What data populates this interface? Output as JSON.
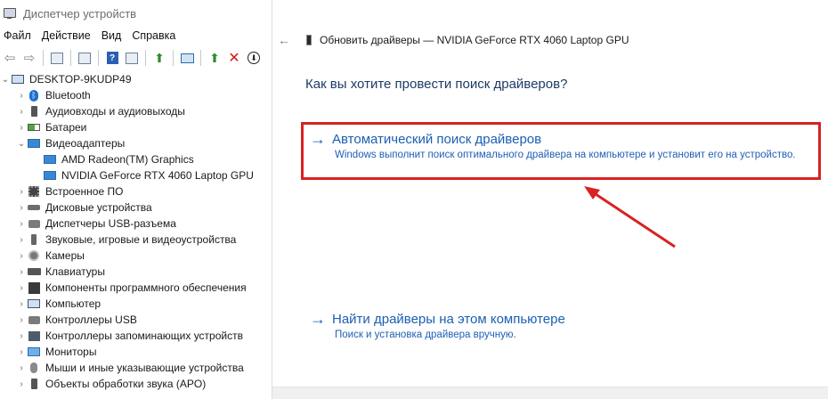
{
  "device_manager": {
    "title": "Диспетчер устройств",
    "menu": [
      "Файл",
      "Действие",
      "Вид",
      "Справка"
    ],
    "root": "DESKTOP-9KUDP49",
    "tree": [
      {
        "label": "Bluetooth",
        "icon": "bluetooth-icon",
        "expanded": false
      },
      {
        "label": "Аудиовходы и аудиовыходы",
        "icon": "speaker-icon",
        "expanded": false
      },
      {
        "label": "Батареи",
        "icon": "battery-icon",
        "expanded": false
      },
      {
        "label": "Видеоадаптеры",
        "icon": "display-adapter-icon",
        "expanded": true,
        "children": [
          "AMD Radeon(TM) Graphics",
          "NVIDIA GeForce RTX 4060 Laptop GPU"
        ]
      },
      {
        "label": "Встроенное ПО",
        "icon": "firmware-icon",
        "expanded": false
      },
      {
        "label": "Дисковые устройства",
        "icon": "disk-icon",
        "expanded": false
      },
      {
        "label": "Диспетчеры USB-разъема",
        "icon": "usb-icon",
        "expanded": false
      },
      {
        "label": "Звуковые, игровые и видеоустройства",
        "icon": "sound-icon",
        "expanded": false
      },
      {
        "label": "Камеры",
        "icon": "camera-icon",
        "expanded": false
      },
      {
        "label": "Клавиатуры",
        "icon": "keyboard-icon",
        "expanded": false
      },
      {
        "label": "Компоненты программного обеспечения",
        "icon": "software-component-icon",
        "expanded": false
      },
      {
        "label": "Компьютер",
        "icon": "computer-icon",
        "expanded": false
      },
      {
        "label": "Контроллеры USB",
        "icon": "usb-controller-icon",
        "expanded": false
      },
      {
        "label": "Контроллеры запоминающих устройств",
        "icon": "storage-controller-icon",
        "expanded": false
      },
      {
        "label": "Мониторы",
        "icon": "monitor-icon",
        "expanded": false
      },
      {
        "label": "Мыши и иные указывающие устройства",
        "icon": "mouse-icon",
        "expanded": false
      },
      {
        "label": "Объекты обработки звука (APO)",
        "icon": "apo-icon",
        "expanded": false
      }
    ]
  },
  "update_dialog": {
    "header": "Обновить драйверы — NVIDIA GeForce RTX 4060 Laptop GPU",
    "question": "Как вы хотите провести поиск драйверов?",
    "auto": {
      "title": "Автоматический поиск драйверов",
      "desc": "Windows выполнит поиск оптимального драйвера на компьютере и установит его на устройство."
    },
    "manual": {
      "title": "Найти драйверы на этом компьютере",
      "desc": "Поиск и установка драйвера вручную."
    }
  },
  "colors": {
    "accent_link": "#1b5fb2",
    "annotation_red": "#d92222"
  }
}
